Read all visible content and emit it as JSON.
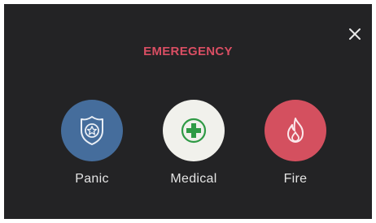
{
  "dialog": {
    "title": "EMEREGENCY",
    "close_icon": "close-icon"
  },
  "options": [
    {
      "label": "Panic",
      "icon": "police-badge-icon",
      "color": "#456d9c"
    },
    {
      "label": "Medical",
      "icon": "medical-cross-icon",
      "color": "#f1f1ec"
    },
    {
      "label": "Fire",
      "icon": "flame-icon",
      "color": "#d4505f"
    }
  ],
  "colors": {
    "background": "#232325",
    "title": "#d94e63",
    "label": "#e4e4e4",
    "medical_cross": "#2f9a45"
  }
}
